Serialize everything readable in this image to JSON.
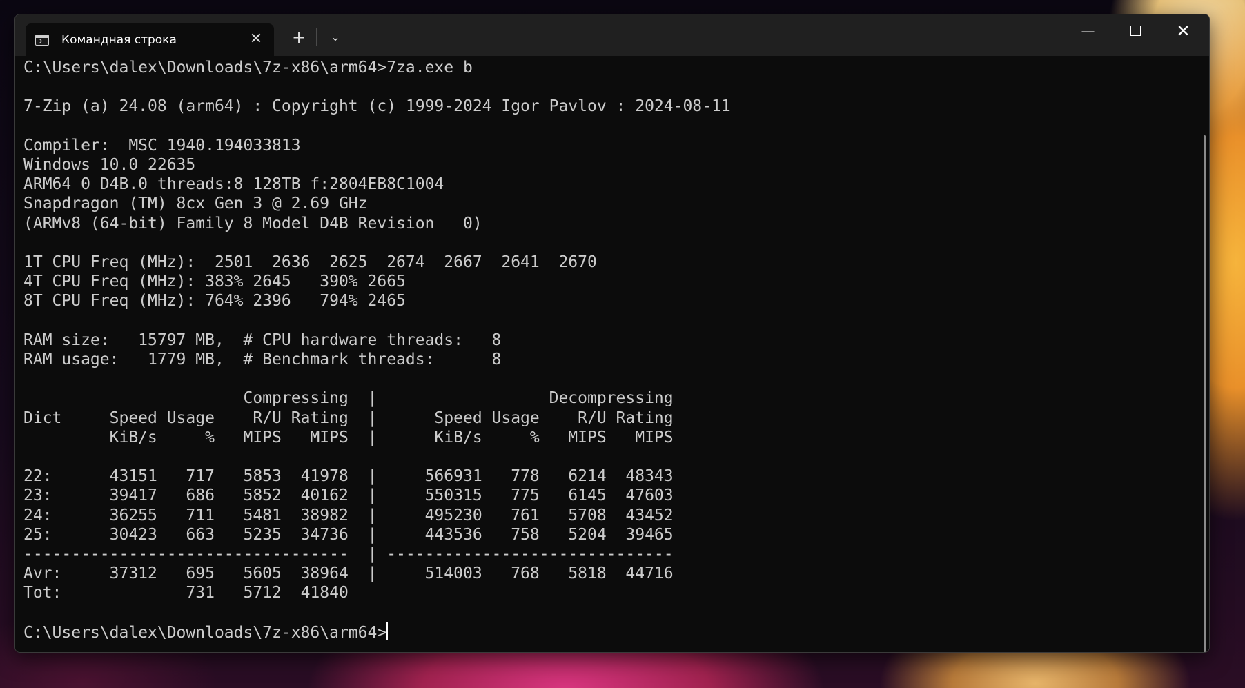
{
  "window": {
    "tab_title": "Командная строка",
    "tab_icon": "command-prompt-icon",
    "tab_close": "✕",
    "new_tab": "+",
    "dropdown": "⌄",
    "minimize": "—",
    "close": "✕"
  },
  "terminal": {
    "lines": [
      "C:\\Users\\dalex\\Downloads\\7z-x86\\arm64>7za.exe b",
      "",
      "7-Zip (a) 24.08 (arm64) : Copyright (c) 1999-2024 Igor Pavlov : 2024-08-11",
      "",
      "Compiler:  MSC 1940.194033813",
      "Windows 10.0 22635",
      "ARM64 0 D4B.0 threads:8 128TB f:2804EB8C1004",
      "Snapdragon (TM) 8cx Gen 3 @ 2.69 GHz",
      "(ARMv8 (64-bit) Family 8 Model D4B Revision   0)",
      "",
      "1T CPU Freq (MHz):  2501  2636  2625  2674  2667  2641  2670",
      "4T CPU Freq (MHz): 383% 2645   390% 2665",
      "8T CPU Freq (MHz): 764% 2396   794% 2465",
      "",
      "RAM size:   15797 MB,  # CPU hardware threads:   8",
      "RAM usage:   1779 MB,  # Benchmark threads:      8",
      "",
      "                       Compressing  |                  Decompressing",
      "Dict     Speed Usage    R/U Rating  |      Speed Usage    R/U Rating",
      "         KiB/s     %   MIPS   MIPS  |      KiB/s     %   MIPS   MIPS",
      "",
      "22:      43151   717   5853  41978  |     566931   778   6214  48343",
      "23:      39417   686   5852  40162  |     550315   775   6145  47603",
      "24:      36255   711   5481  38982  |     495230   761   5708  43452",
      "25:      30423   663   5235  34736  |     443536   758   5204  39465",
      "----------------------------------  | ------------------------------",
      "Avr:     37312   695   5605  38964  |     514003   768   5818  44716",
      "Tot:             731   5712  41840",
      ""
    ],
    "prompt": "C:\\Users\\dalex\\Downloads\\7z-x86\\arm64>"
  },
  "colors": {
    "terminal_bg": "#0c0c0c",
    "terminal_fg": "#cccccc",
    "titlebar_bg": "#202020"
  }
}
